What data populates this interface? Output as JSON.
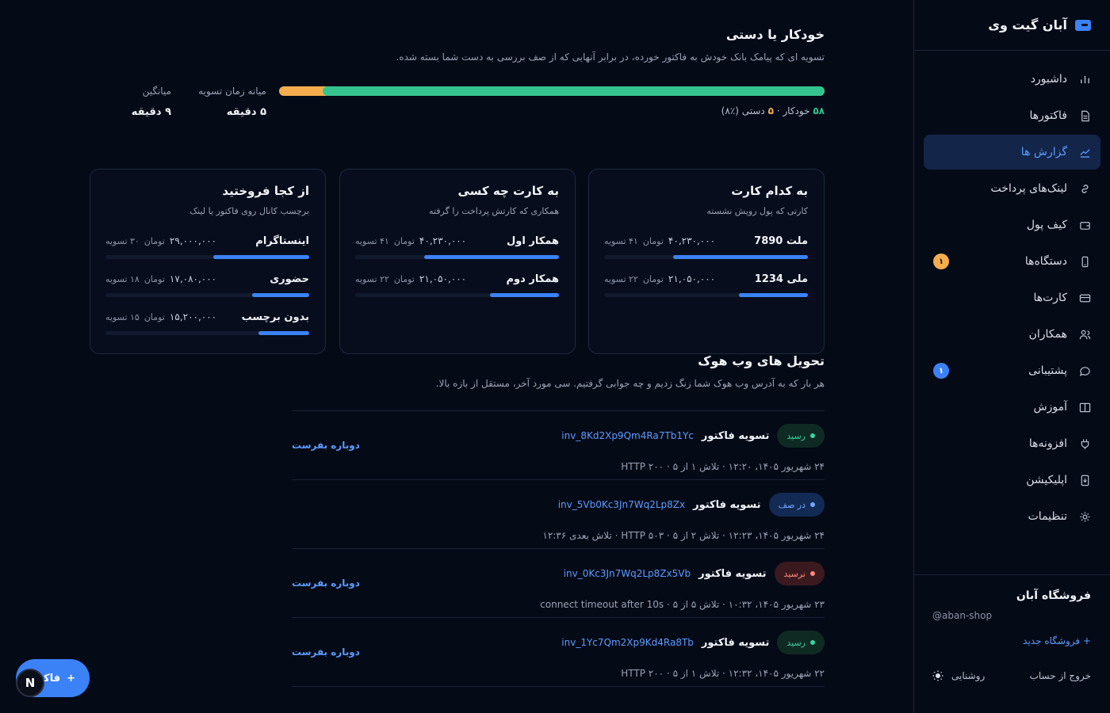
{
  "sidebar": {
    "brand": "آبان گیت وی",
    "items": [
      {
        "label": "داشبورد",
        "icon": "bar-chart-icon"
      },
      {
        "label": "فاکتورها",
        "icon": "document-icon"
      },
      {
        "label": "گزارش ها",
        "icon": "trend-chart-icon",
        "active": true
      },
      {
        "label": "لینک‌های پرداخت",
        "icon": "link-icon"
      },
      {
        "label": "کیف پول",
        "icon": "wallet-icon"
      },
      {
        "label": "دستگاه‌ها",
        "icon": "phone-icon",
        "badge": "۱"
      },
      {
        "label": "کارت‌ها",
        "icon": "credit-card-icon"
      },
      {
        "label": "همکاران",
        "icon": "users-icon"
      },
      {
        "label": "پشتیبانی",
        "icon": "chat-icon",
        "badge": "۱"
      },
      {
        "label": "آموزش",
        "icon": "book-icon"
      },
      {
        "label": "افزونه‌ها",
        "icon": "plug-icon"
      },
      {
        "label": "اپلیکیشن",
        "icon": "app-download-icon"
      },
      {
        "label": "تنظیمات",
        "icon": "gear-icon"
      }
    ],
    "footer": {
      "shop_name": "فروشگاه آبان",
      "shop_handle": "@aban-shop",
      "new_shop": "+ فروشگاه جدید",
      "logout": "خروج از حساب",
      "theme_label": "روشنایی"
    }
  },
  "auto": {
    "title": "خودکار یا دستی",
    "desc": "تسویه ای که پیامک بانک خودش به فاکتور خورده، در برابر آنهایی که از صف بررسی به دست شما بسته شده.",
    "auto_count": "۵۸",
    "auto_label": "خودکار",
    "sep": "·",
    "manual_count": "۵",
    "manual_label": "دستی (٪۸)",
    "auto_fraction": 0.92,
    "stat_median_label": "میانه زمان تسویه",
    "stat_median_value": "۵ دقیقه",
    "stat_avg_label": "میانگین",
    "stat_avg_value": "۹ دقیقه"
  },
  "cards": [
    {
      "title": "به کدام کارت",
      "sub": "کارتی که پول رویش نشسته",
      "rows": [
        {
          "name": "ملت 7890",
          "amount": "۴۰,۲۳۰,۰۰۰",
          "unit": "تومان",
          "count": "۴۱ تسویه",
          "fraction": 0.66
        },
        {
          "name": "ملی 1234",
          "amount": "۲۱,۰۵۰,۰۰۰",
          "unit": "تومان",
          "count": "۲۲ تسویه",
          "fraction": 0.34
        }
      ]
    },
    {
      "title": "به کارت چه کسی",
      "sub": "همکاری که کارتش پرداخت را گرفته",
      "rows": [
        {
          "name": "همکار اول",
          "amount": "۴۰,۲۳۰,۰۰۰",
          "unit": "تومان",
          "count": "۴۱ تسویه",
          "fraction": 0.66
        },
        {
          "name": "همکار دوم",
          "amount": "۲۱,۰۵۰,۰۰۰",
          "unit": "تومان",
          "count": "۲۲ تسویه",
          "fraction": 0.34
        }
      ]
    },
    {
      "title": "از کجا فروختید",
      "sub": "برچسب کانال روی فاکتور یا لینک",
      "rows": [
        {
          "name": "اینستاگرام",
          "amount": "۲۹,۰۰۰,۰۰۰",
          "unit": "تومان",
          "count": "۳۰ تسویه",
          "fraction": 0.47
        },
        {
          "name": "حضوری",
          "amount": "۱۷,۰۸۰,۰۰۰",
          "unit": "تومان",
          "count": "۱۸ تسویه",
          "fraction": 0.28
        },
        {
          "name": "بدون برچسب",
          "amount": "۱۵,۲۰۰,۰۰۰",
          "unit": "تومان",
          "count": "۱۵ تسویه",
          "fraction": 0.25
        }
      ]
    }
  ],
  "webhook": {
    "title": "تحویل های وب هوک",
    "desc": "هر بار که به آدرس وب هوک شما زنگ زدیم و چه جوابی گرفتیم. سی مورد آخر، مستقل از بازه بالا.",
    "retry_label": "دوباره بفرست",
    "items": [
      {
        "status": "رسید",
        "kind": "ok",
        "event": "تسویه فاکتور",
        "invoice": "inv_8Kd2Xp9Qm4Ra7Tb1Yc",
        "meta": "۲۴ شهریور ۱۴۰۵، ۱۲:۲۰ · تلاش ۱ از ۵ · HTTP ۲۰۰",
        "retry": true
      },
      {
        "status": "در صف",
        "kind": "queue",
        "event": "تسویه فاکتور",
        "invoice": "inv_5Vb0Kc3Jn7Wq2Lp8Zx",
        "meta": "۲۴ شهریور ۱۴۰۵، ۱۲:۲۳ · تلاش ۲ از ۵ · HTTP ۵۰۳ · تلاش بعدی ۱۲:۳۶",
        "retry": false
      },
      {
        "status": "نرسید",
        "kind": "fail",
        "event": "تسویه فاکتور",
        "invoice": "inv_0Kc3Jn7Wq2Lp8Zx5Vb",
        "meta": "۲۳ شهریور ۱۴۰۵، ۱۰:۳۲ · تلاش ۵ از ۵ · connect timeout after 10s",
        "retry": true
      },
      {
        "status": "رسید",
        "kind": "ok",
        "event": "تسویه فاکتور",
        "invoice": "inv_1Yc7Qm2Xp9Kd4Ra8Tb",
        "meta": "۲۲ شهریور ۱۴۰۵، ۱۲:۳۲ · تلاش ۱ از ۵ · HTTP ۲۰۰",
        "retry": true
      }
    ]
  },
  "fab": {
    "label": "فاکتور",
    "plus": "+"
  },
  "n_badge": "N",
  "colors": {
    "accent": "#3b82f6",
    "green": "#34c38f",
    "orange": "#f6ad4e",
    "bg": "#050a17"
  }
}
